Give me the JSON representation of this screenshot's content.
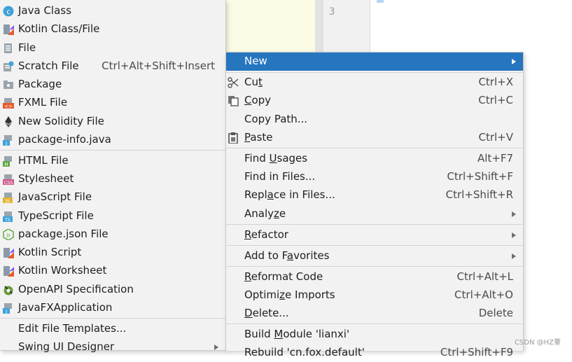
{
  "editor": {
    "line_numbers": [
      "3"
    ]
  },
  "left_menu": {
    "items": [
      {
        "label": "Java Class",
        "icon": "java-class-icon"
      },
      {
        "label": "Kotlin Class/File",
        "icon": "kotlin-icon"
      },
      {
        "label": "File",
        "icon": "file-icon"
      },
      {
        "label": "Scratch File",
        "shortcut": "Ctrl+Alt+Shift+Insert",
        "icon": "scratch-file-icon"
      },
      {
        "label": "Package",
        "icon": "package-icon"
      },
      {
        "label": "FXML File",
        "icon": "fxml-file-icon"
      },
      {
        "label": "New Solidity File",
        "icon": "solidity-icon"
      },
      {
        "label": "package-info.java",
        "icon": "java-file-icon"
      },
      {
        "label": "HTML File",
        "icon": "html-file-icon"
      },
      {
        "label": "Stylesheet",
        "icon": "css-file-icon"
      },
      {
        "label": "JavaScript File",
        "icon": "js-file-icon"
      },
      {
        "label": "TypeScript File",
        "icon": "ts-file-icon"
      },
      {
        "label": "package.json File",
        "icon": "nodejs-icon"
      },
      {
        "label": "Kotlin Script",
        "icon": "kotlin-script-icon"
      },
      {
        "label": "Kotlin Worksheet",
        "icon": "kotlin-worksheet-icon"
      },
      {
        "label": "OpenAPI Specification",
        "icon": "openapi-icon"
      },
      {
        "label": "JavaFXApplication",
        "icon": "javafx-icon"
      },
      {
        "label": "Edit File Templates..."
      },
      {
        "label": "Swing UI Designer"
      }
    ]
  },
  "right_menu": {
    "new": {
      "label": "New"
    },
    "cut": {
      "pre": "Cu",
      "u": "t",
      "post": "",
      "shortcut": "Ctrl+X"
    },
    "copy": {
      "pre": "",
      "u": "C",
      "post": "opy",
      "shortcut": "Ctrl+C"
    },
    "copy_path": {
      "label": "Copy Path..."
    },
    "paste": {
      "pre": "",
      "u": "P",
      "post": "aste",
      "shortcut": "Ctrl+V"
    },
    "find_usages": {
      "pre": "Find ",
      "u": "U",
      "post": "sages",
      "shortcut": "Alt+F7"
    },
    "find_in_files": {
      "label": "Find in Files...",
      "shortcut": "Ctrl+Shift+F"
    },
    "replace_in_files": {
      "pre": "Repl",
      "u": "a",
      "post": "ce in Files...",
      "shortcut": "Ctrl+Shift+R"
    },
    "analyze": {
      "pre": "Analy",
      "u": "z",
      "post": "e"
    },
    "refactor": {
      "pre": "",
      "u": "R",
      "post": "efactor"
    },
    "add_to_favorites": {
      "pre": "Add to F",
      "u": "a",
      "post": "vorites"
    },
    "reformat_code": {
      "pre": "",
      "u": "R",
      "post": "eformat Code",
      "shortcut": "Ctrl+Alt+L"
    },
    "optimize_imports": {
      "pre": "Optimi",
      "u": "z",
      "post": "e Imports",
      "shortcut": "Ctrl+Alt+O"
    },
    "delete": {
      "pre": "",
      "u": "D",
      "post": "elete...",
      "shortcut": "Delete"
    },
    "build_module": {
      "pre": "Build ",
      "u": "M",
      "post": "odule 'lianxi'"
    },
    "rebuild": {
      "label": "Rebuild 'cn.fox.default'",
      "shortcut": "Ctrl+Shift+F9"
    }
  },
  "watermark": "CSDN @HZ董"
}
